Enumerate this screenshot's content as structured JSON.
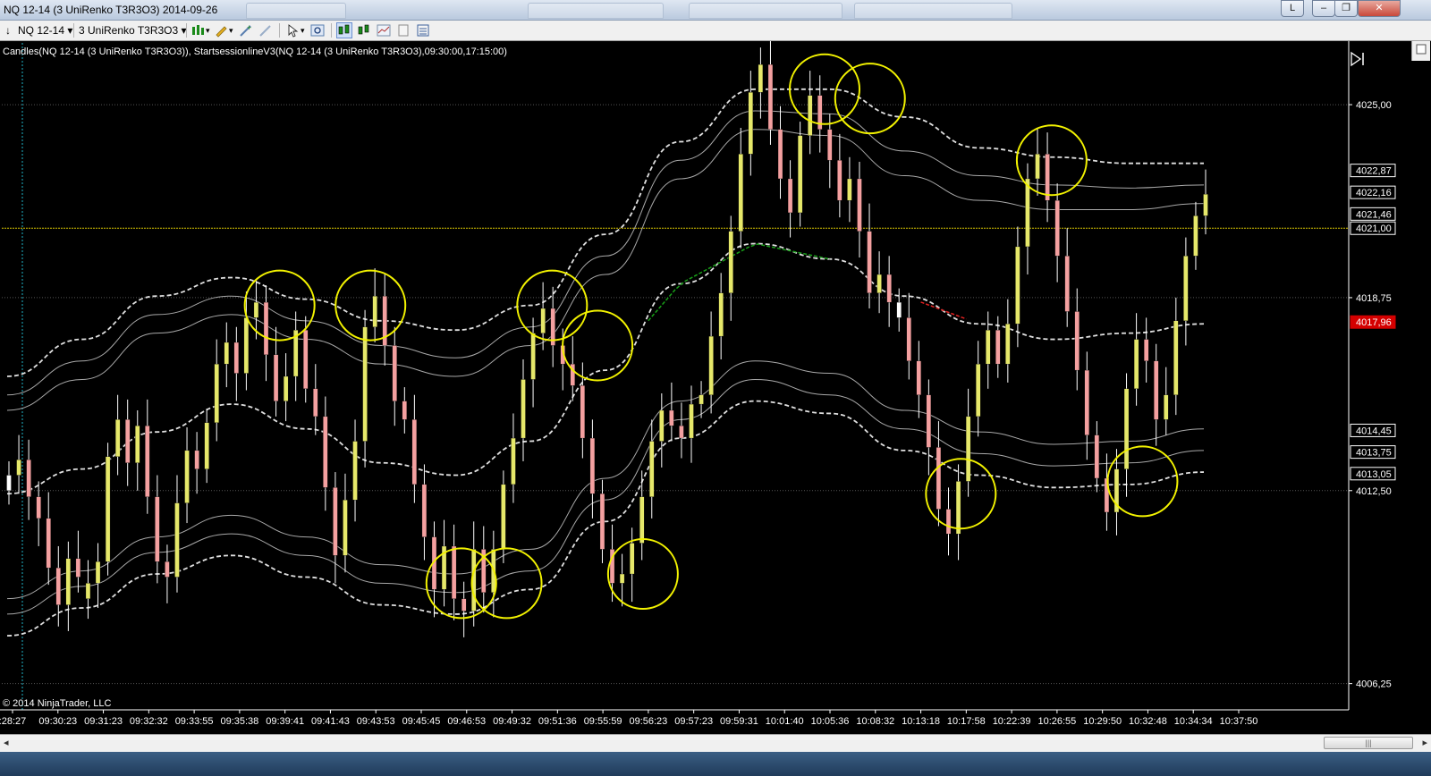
{
  "window": {
    "title": "NQ 12-14 (3 UniRenko T3R3O3)  2014-09-26",
    "buttons": [
      "L",
      "–",
      "❐",
      "✕"
    ]
  },
  "toolbar": {
    "instrument": "NQ 12-14",
    "period": "3 UniRenko T3R3O3"
  },
  "indicator_label": "Candles(NQ 12-14 (3 UniRenko T3R3O3)), StartsessionlineV3(NQ 12-14 (3 UniRenko T3R3O3),09:30:00,17:15:00)",
  "copyright": "© 2014 NinjaTrader, LLC",
  "colors": {
    "background": "#000000",
    "up_candle": "#e6e86a",
    "down_candle": "#f4a0a0",
    "flat_candle": "#ffffff",
    "wick": "#ffffff",
    "circle": "#f2f200",
    "current_price_line": "#d6c300",
    "price_marker": "#d40000",
    "band_line": "#c8c8c8"
  },
  "chart_data": {
    "type": "candlestick",
    "y_axis": {
      "min": 4005.4,
      "max": 4027.0,
      "gridlines": [
        4025.0,
        4018.75,
        4012.5,
        4006.25
      ],
      "grid_labels": [
        "4025,00",
        "4018,75",
        "4012,50",
        "4006,25"
      ],
      "price_tags": [
        {
          "value": 4022.87,
          "label": "4022,87",
          "style": "normal"
        },
        {
          "value": 4022.16,
          "label": "4022,16",
          "style": "normal"
        },
        {
          "value": 4021.46,
          "label": "4021,46",
          "style": "normal"
        },
        {
          "value": 4021.0,
          "label": "4021,00",
          "style": "current"
        },
        {
          "value": 4017.96,
          "label": "4017,96",
          "style": "red"
        },
        {
          "value": 4014.45,
          "label": "4014,45",
          "style": "normal"
        },
        {
          "value": 4013.75,
          "label": "4013,75",
          "style": "normal"
        },
        {
          "value": 4013.05,
          "label": "4013,05",
          "style": "normal"
        }
      ],
      "current_price": 4021.0
    },
    "x_labels": [
      ":28:27",
      "09:30:23",
      "09:31:23",
      "09:32:32",
      "09:33:55",
      "09:35:38",
      "09:39:41",
      "09:41:43",
      "09:43:53",
      "09:45:45",
      "09:46:53",
      "09:49:32",
      "09:51:36",
      "09:55:59",
      "09:56:23",
      "09:57:23",
      "09:59:31",
      "10:01:40",
      "10:05:36",
      "10:08:32",
      "10:13:18",
      "10:17:58",
      "10:22:39",
      "10:26:55",
      "10:29:50",
      "10:32:48",
      "10:34:34",
      "10:37:50"
    ],
    "price_path": [
      4013.0,
      4013.5,
      4012.3,
      4011.6,
      4010.0,
      4008.8,
      4010.3,
      4009.7,
      4009.5,
      4010.2,
      4013.6,
      4014.8,
      4013.4,
      4014.6,
      4012.3,
      4010.2,
      4009.7,
      4012.1,
      4013.8,
      4013.2,
      4014.7,
      4016.6,
      4017.3,
      4016.3,
      4018.1,
      4018.6,
      4016.9,
      4015.4,
      4016.2,
      4017.7,
      4015.8,
      4014.9,
      4012.6,
      4010.4,
      4012.2,
      4014.1,
      4017.8,
      4018.8,
      4017.2,
      4015.4,
      4014.8,
      4012.7,
      4011.0,
      4009.3,
      4010.7,
      4009.0,
      4008.6,
      4010.6,
      4009.2,
      4010.6,
      4012.7,
      4014.2,
      4016.1,
      4017.6,
      4018.4,
      4017.2,
      4016.6,
      4015.9,
      4014.2,
      4012.4,
      4010.6,
      4009.5,
      4009.8,
      4010.8,
      4012.3,
      4014.1,
      4015.1,
      4014.6,
      4014.2,
      4015.3,
      4015.6,
      4017.5,
      4018.9,
      4020.9,
      4023.4,
      4025.4,
      4026.3,
      4024.2,
      4022.6,
      4021.5,
      4024.0,
      4025.3,
      4024.2,
      4023.2,
      4021.9,
      4022.6,
      4020.9,
      4018.9,
      4019.5,
      4018.6,
      4018.1,
      4016.7,
      4015.6,
      4013.9,
      4011.9,
      4011.1,
      4012.8,
      4014.9,
      4016.6,
      4017.7,
      4016.6,
      4017.9,
      4020.4,
      4022.6,
      4023.4,
      4021.9,
      4020.1,
      4018.3,
      4016.4,
      4014.3,
      4012.9,
      4011.8,
      4013.2,
      4015.8,
      4017.4,
      4016.7,
      4014.8,
      4015.6,
      4018.0,
      4020.1,
      4021.4,
      4022.1
    ],
    "bands": [
      {
        "name": "upper outer",
        "style": "dashed",
        "values": [
          4016.2,
          4017.4,
          4018.8,
          4019.4,
          4018.7,
          4018.0,
          4017.7,
          4018.5,
          4020.8,
          4023.8,
          4025.5,
          4025.5,
          4024.6,
          4023.6,
          4023.3,
          4023.1,
          4023.1
        ]
      },
      {
        "name": "upper middle",
        "style": "solid",
        "values": [
          4015.6,
          4016.7,
          4018.2,
          4018.8,
          4018.0,
          4017.2,
          4016.8,
          4017.8,
          4020.1,
          4023.2,
          4024.8,
          4024.7,
          4023.5,
          4022.7,
          4022.4,
          4022.3,
          4022.4
        ]
      },
      {
        "name": "upper inner",
        "style": "solid",
        "values": [
          4015.1,
          4016.1,
          4017.6,
          4018.2,
          4017.4,
          4016.6,
          4016.2,
          4017.2,
          4019.5,
          4022.6,
          4024.2,
          4024.0,
          4022.7,
          4021.9,
          4021.6,
          4021.6,
          4021.8
        ]
      },
      {
        "name": "median",
        "style": "dashed",
        "values": [
          4012.4,
          4013.2,
          4014.4,
          4015.3,
          4014.5,
          4013.4,
          4013.0,
          4014.1,
          4016.4,
          4019.2,
          4020.5,
          4020.0,
          4018.8,
          4017.9,
          4017.4,
          4017.6,
          4017.9
        ]
      },
      {
        "name": "lower inner",
        "style": "solid",
        "values": [
          4009.0,
          4009.9,
          4011.0,
          4011.7,
          4011.0,
          4010.1,
          4009.8,
          4010.6,
          4012.9,
          4015.4,
          4016.7,
          4016.3,
          4015.1,
          4014.4,
          4014.0,
          4014.1,
          4014.5
        ]
      },
      {
        "name": "lower middle",
        "style": "solid",
        "values": [
          4008.5,
          4009.4,
          4010.5,
          4011.1,
          4010.4,
          4009.5,
          4009.2,
          4009.9,
          4012.2,
          4014.8,
          4016.1,
          4015.6,
          4014.5,
          4013.7,
          4013.3,
          4013.4,
          4013.8
        ]
      },
      {
        "name": "lower outer",
        "style": "dashed",
        "values": [
          4007.8,
          4008.7,
          4009.8,
          4010.4,
          4009.7,
          4008.8,
          4008.5,
          4009.3,
          4011.5,
          4014.2,
          4015.4,
          4015.0,
          4013.8,
          4013.0,
          4012.6,
          4012.7,
          4013.1
        ]
      }
    ],
    "session_line": {
      "green_segment": {
        "from_time": "09:56:23",
        "to_time": "10:05:36"
      },
      "red_segment": {
        "from_time": "10:13:18",
        "to_time": "10:17:58"
      }
    },
    "circles": [
      {
        "time": "09:39:41",
        "price": 4018.5,
        "type": "high"
      },
      {
        "time": "09:43:53",
        "price": 4018.5,
        "type": "high"
      },
      {
        "time": "09:46:53",
        "price": 4009.5,
        "type": "low"
      },
      {
        "time": "09:49:32",
        "price": 4009.5,
        "type": "low"
      },
      {
        "time": "09:51:36",
        "price": 4018.5,
        "type": "high"
      },
      {
        "time": "09:55:59",
        "price": 4017.2,
        "type": "high"
      },
      {
        "time": "09:56:23",
        "price": 4009.8,
        "type": "low"
      },
      {
        "time": "10:05:36",
        "price": 4025.5,
        "type": "high"
      },
      {
        "time": "10:08:32",
        "price": 4025.2,
        "type": "high"
      },
      {
        "time": "10:17:58",
        "price": 4012.4,
        "type": "low"
      },
      {
        "time": "10:26:55",
        "price": 4023.2,
        "type": "high"
      },
      {
        "time": "10:32:48",
        "price": 4012.8,
        "type": "low"
      }
    ]
  }
}
